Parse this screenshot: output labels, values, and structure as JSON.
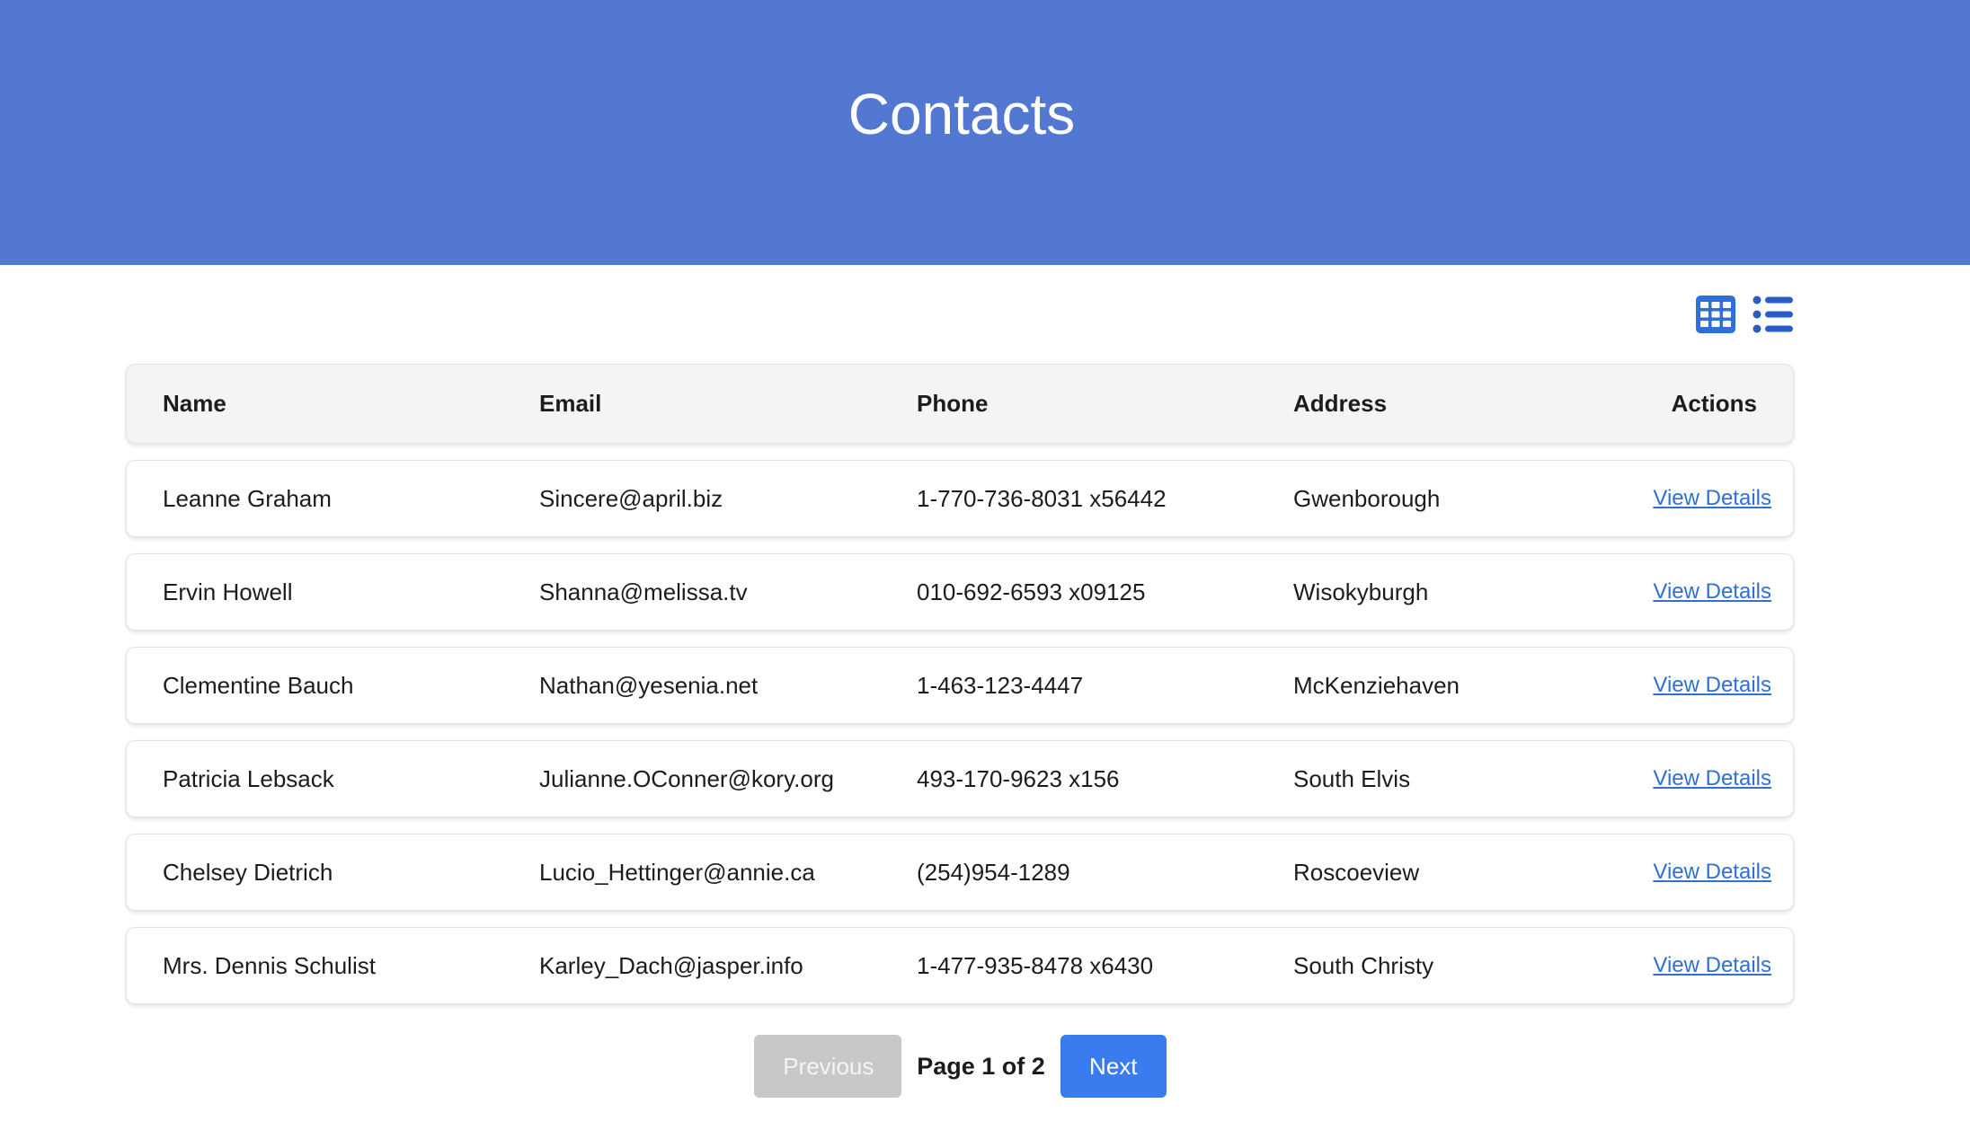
{
  "header": {
    "title": "Contacts"
  },
  "view_toggle": {
    "icons": [
      "grid-view-icon",
      "list-view-icon"
    ],
    "accent_color": "#2f6fd6"
  },
  "table": {
    "columns": [
      "Name",
      "Email",
      "Phone",
      "Address",
      "Actions"
    ],
    "rows": [
      {
        "name": "Leanne Graham",
        "email": "Sincere@april.biz",
        "phone": "1-770-736-8031 x56442",
        "address": "Gwenborough",
        "action": "View Details"
      },
      {
        "name": "Ervin Howell",
        "email": "Shanna@melissa.tv",
        "phone": "010-692-6593 x09125",
        "address": "Wisokyburgh",
        "action": "View Details"
      },
      {
        "name": "Clementine Bauch",
        "email": "Nathan@yesenia.net",
        "phone": "1-463-123-4447",
        "address": "McKenziehaven",
        "action": "View Details"
      },
      {
        "name": "Patricia Lebsack",
        "email": "Julianne.OConner@kory.org",
        "phone": "493-170-9623 x156",
        "address": "South Elvis",
        "action": "View Details"
      },
      {
        "name": "Chelsey Dietrich",
        "email": "Lucio_Hettinger@annie.ca",
        "phone": "(254)954-1289",
        "address": "Roscoeview",
        "action": "View Details"
      },
      {
        "name": "Mrs. Dennis Schulist",
        "email": "Karley_Dach@jasper.info",
        "phone": "1-477-935-8478 x6430",
        "address": "South Christy",
        "action": "View Details"
      }
    ]
  },
  "pagination": {
    "previous_label": "Previous",
    "page_info": "Page 1 of 2",
    "next_label": "Next"
  },
  "colors": {
    "header_bg": "#5378d1",
    "next_button": "#3a7bf0",
    "previous_button_disabled": "#c8c8c8",
    "link": "#2f6fd6"
  }
}
